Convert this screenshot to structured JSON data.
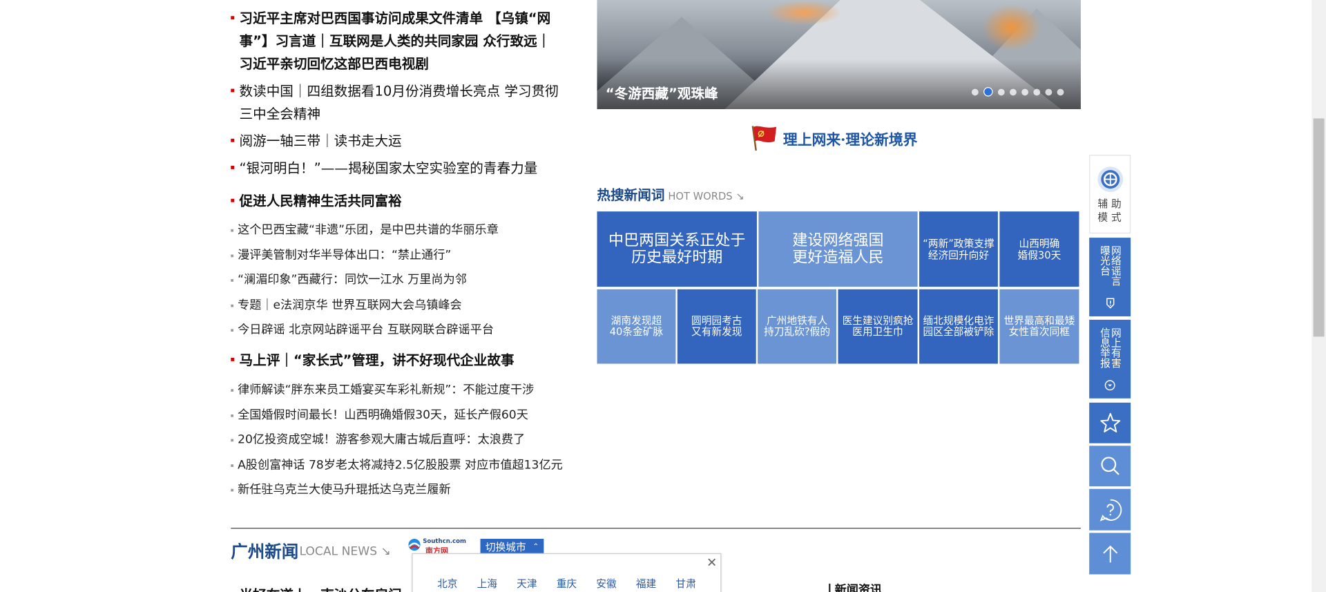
{
  "left_news": {
    "headline_big": [
      "习近平主席对巴西国事访问成果文件清单 【乌镇“网",
      "事”】习言道｜互联网是人类的共同家园 众行致远｜",
      "习近平亲切回忆这部巴西电视剧"
    ],
    "headline_2": [
      "数读中国｜四组数据看10月份消费增长亮点 学习贯彻",
      "三中全会精神"
    ],
    "headline_3": "阅游一轴三带｜读书走大运",
    "headline_4": "“银河明白！”——揭秘国家太空实验室的青春力量",
    "section_1": {
      "title": "促进人民精神生活共同富裕",
      "items": [
        "这个巴西宝藏“非遗”乐团，是中巴共谱的华丽乐章",
        "漫评美管制对华半导体出口：“禁止通行”",
        "“澜湄印象”西藏行：同饮一江水 万里尚为邻",
        "专题｜e法润京华 世界互联网大会乌镇峰会",
        "今日辟谣 北京网站辟谣平台 互联网联合辟谣平台"
      ]
    },
    "section_2": {
      "title": "马上评｜“家长式”管理，讲不好现代企业故事",
      "items": [
        "律师解读“胖东来员工婚宴买车彩礼新规”：不能过度干涉",
        "全国婚假时间最长！山西明确婚假30天，延长产假60天",
        "20亿投资成空城！游客参观大庸古城后直呼：太浪费了",
        "A股创富神话 78岁老太将减持2.5亿股股票 对应市值超13亿元",
        "新任驻乌克兰大使马升琨抵达乌克兰履新"
      ]
    }
  },
  "hero": {
    "caption": "“冬游西藏”观珠峰",
    "slide_count": 8,
    "active_slide": 2
  },
  "theory_banner": {
    "text": "理上网来·理论新境界",
    "flag_color": "#d21e1e"
  },
  "hot_words": {
    "title_cn": "热搜新闻词",
    "title_en": "HOT WORDS",
    "arrow": "↘",
    "tiles": [
      [
        "中巴两国关系正处于",
        "历史最好时期"
      ],
      [
        "建设网络强国",
        "更好造福人民"
      ],
      [
        "“两新”政策支撑",
        "经济回升向好"
      ],
      [
        "山西明确",
        "婚假30天"
      ],
      [
        "湖南发现超",
        "40条金矿脉"
      ],
      [
        "圆明园考古",
        "又有新发现"
      ],
      [
        "广州地铁有人",
        "持刀乱砍?假的"
      ],
      [
        "医生建议别疯抢",
        "医用卫生巾"
      ],
      [
        "缅北规模化电诈",
        "园区全部被铲除"
      ],
      [
        "世界最高和最矮",
        "女性首次同框"
      ]
    ],
    "colors": {
      "dark": "#3364be",
      "light": "#6a94d4"
    }
  },
  "local_news": {
    "title_cn": "广州新闻",
    "title_en": "LOCAL NEWS",
    "arrow": "↘",
    "logo_en": "Southcn.com",
    "logo_cn": "南方网",
    "switch_label": "切换城市",
    "switch_caret": "⌃",
    "close_label": "✕",
    "cities": [
      "北京",
      "上海",
      "天津",
      "重庆",
      "安徽",
      "福建",
      "甘肃"
    ],
    "headline_partial": "光好在道上　南沙公车房门",
    "news_info_title": "新闻资讯"
  },
  "tools": {
    "assist_mode": [
      "辅",
      "助",
      "模",
      "式"
    ],
    "rumor": "网络谣言曝光台",
    "report": "网上有害信息举报"
  },
  "icons": [
    "assist-icon",
    "warning-icon",
    "chevron-down-icon",
    "star-icon",
    "search-icon",
    "help-icon",
    "arrow-up-icon",
    "party-flag-icon",
    "close-icon"
  ]
}
